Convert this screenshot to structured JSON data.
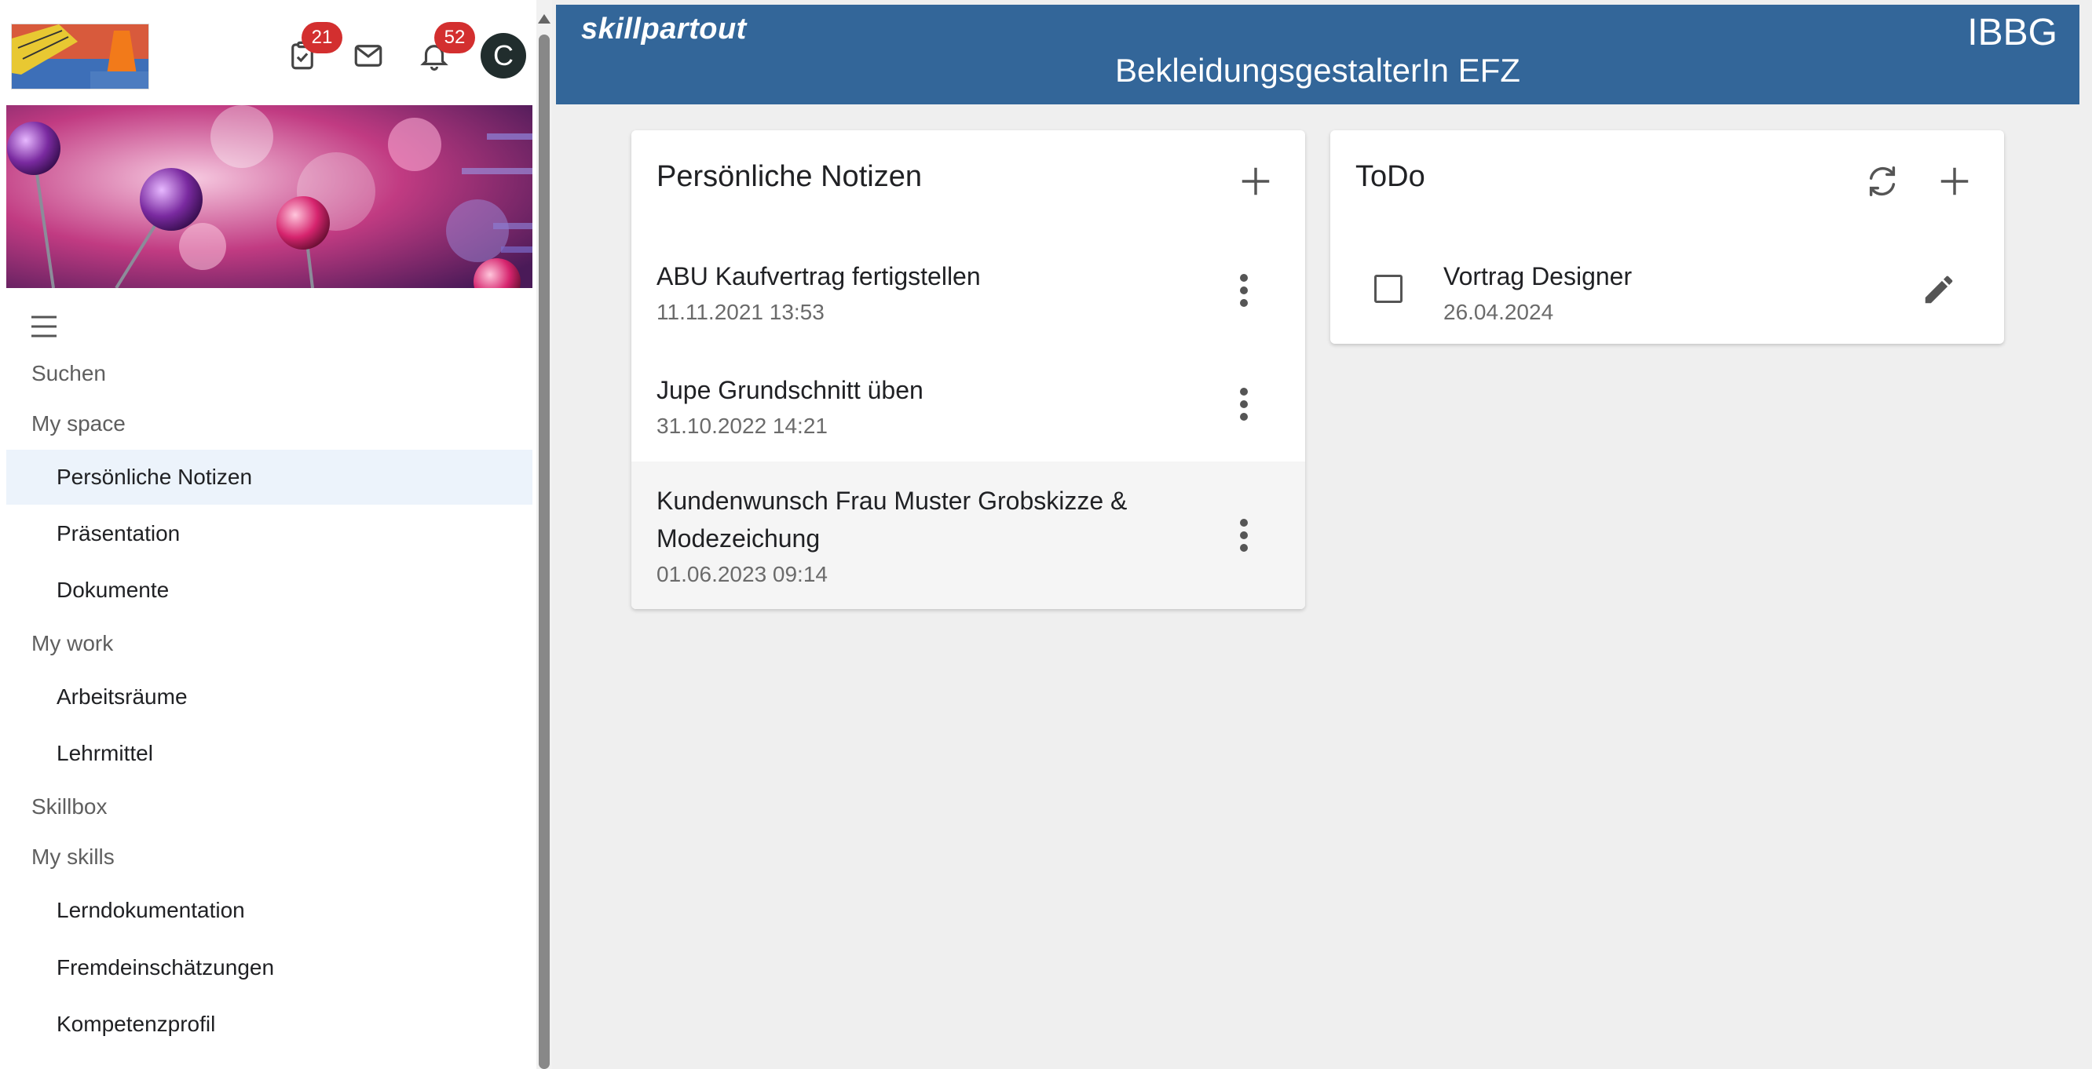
{
  "header": {
    "brand": "skillpartout",
    "title": "BekleidungsgestalterIn EFZ",
    "org": "IBBG",
    "color": "#336699"
  },
  "sidebar": {
    "badges": {
      "tasks": "21",
      "notifications": "52"
    },
    "avatar": "C",
    "sections": [
      {
        "label": "Suchen"
      },
      {
        "label": "My space",
        "items": [
          "Persönliche Notizen",
          "Präsentation",
          "Dokumente"
        ]
      },
      {
        "label": "My work",
        "items": [
          "Arbeitsräume",
          "Lehrmittel"
        ]
      },
      {
        "label": "Skillbox"
      },
      {
        "label": "My skills",
        "items": [
          "Lerndokumentation",
          "Fremdeinschätzungen",
          "Kompetenzprofil"
        ]
      }
    ],
    "active_item": "Persönliche Notizen"
  },
  "notes": {
    "title": "Persönliche Notizen",
    "items": [
      {
        "title": "ABU Kaufvertrag fertigstellen",
        "date": "11.11.2021 13:53"
      },
      {
        "title": "Jupe Grundschnitt üben",
        "date": "31.10.2022 14:21"
      },
      {
        "title": "Kundenwunsch Frau Muster Grobskizze & Modezeichung",
        "date": "01.06.2023 09:14"
      }
    ]
  },
  "todo": {
    "title": "ToDo",
    "items": [
      {
        "title": "Vortrag Designer",
        "date": "26.04.2024",
        "checked": false
      }
    ]
  }
}
